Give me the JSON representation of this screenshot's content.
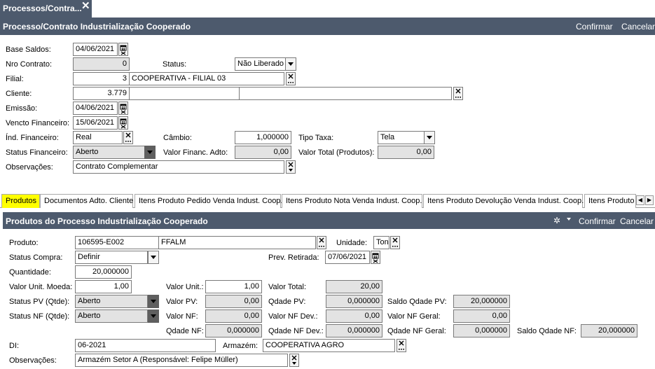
{
  "window_tab": {
    "title": "Processos/Contra...",
    "close": "✕"
  },
  "header": {
    "title": "Processo/Contrato Industrialização Cooperado",
    "confirm": "Confirmar",
    "cancel": "Cancelar"
  },
  "form": {
    "base_saldos_label": "Base Saldos:",
    "base_saldos": "04/06/2021",
    "nro_contrato_label": "Nro Contrato:",
    "nro_contrato": "0",
    "status_label": "Status:",
    "status": "Não Liberado",
    "filial_label": "Filial:",
    "filial_code": "3",
    "filial_name": "COOPERATIVA - FILIAL 03",
    "cliente_label": "Cliente:",
    "cliente_code": "3.779",
    "cliente_name": "",
    "cliente_extra": "",
    "emissao_label": "Emissão:",
    "emissao": "04/06/2021",
    "vencto_label": "Vencto Financeiro:",
    "vencto": "15/06/2021",
    "ind_fin_label": "Índ. Financeiro:",
    "ind_fin": "Real",
    "cambio_label": "Câmbio:",
    "cambio": "1,000000",
    "tipo_taxa_label": "Tipo Taxa:",
    "tipo_taxa": "Tela",
    "status_fin_label": "Status Financeiro:",
    "status_fin": "Aberto",
    "valor_financ_label": "Valor Financ. Adto:",
    "valor_financ": "0,00",
    "valor_total_label": "Valor Total (Produtos):",
    "valor_total": "0,00",
    "obs_label": "Observações:",
    "obs": "Contrato Complementar"
  },
  "tabs": [
    "Produtos",
    "Documentos Adto. Cliente",
    "Itens Produto Pedido Venda Indust. Coop.",
    "Itens Produto Nota Venda Indust. Coop.",
    "Itens Produto Devolução Venda Indust. Coop.",
    "Itens Produto"
  ],
  "sub_header": {
    "title": "Produtos do Processo Industrialização Cooperado",
    "confirm": "Confirmar",
    "cancel": "Cancelar"
  },
  "produto": {
    "produto_label": "Produto:",
    "produto_code": "106595-E002",
    "produto_name": "FFALM",
    "unidade_label": "Unidade:",
    "unidade": "Ton",
    "status_compra_label": "Status Compra:",
    "status_compra": "Definir",
    "prev_retirada_label": "Prev. Retirada:",
    "prev_retirada": "07/06/2021",
    "quantidade_label": "Quantidade:",
    "quantidade": "20,000000",
    "valor_unit_moeda_label": "Valor Unit. Moeda:",
    "valor_unit_moeda": "1,00",
    "valor_unit_label": "Valor Unit.:",
    "valor_unit": "1,00",
    "valor_total_label": "Valor Total:",
    "valor_total": "20,00",
    "status_pv_label": "Status PV (Qtde):",
    "status_pv": "Aberto",
    "valor_pv_label": "Valor PV:",
    "valor_pv": "0,00",
    "qdade_pv_label": "Qdade PV:",
    "qdade_pv": "0,000000",
    "saldo_qdade_pv_label": "Saldo Qdade PV:",
    "saldo_qdade_pv": "20,000000",
    "status_nf_label": "Status NF (Qtde):",
    "status_nf": "Aberto",
    "valor_nf_label": "Valor NF:",
    "valor_nf": "0,00",
    "valor_nf_dev_label": "Valor NF Dev.:",
    "valor_nf_dev": "0,00",
    "valor_nf_geral_label": "Valor NF Geral:",
    "valor_nf_geral": "0,00",
    "qdade_nf_label": "Qdade NF:",
    "qdade_nf": "0,000000",
    "qdade_nf_dev_label": "Qdade NF Dev.:",
    "qdade_nf_dev": "0,000000",
    "qdade_nf_geral_label": "Qdade NF Geral:",
    "qdade_nf_geral": "0,000000",
    "saldo_qdade_nf_label": "Saldo Qdade NF:",
    "saldo_qdade_nf": "20,000000",
    "di_label": "DI:",
    "di": "06-2021",
    "armazem_label": "Armazém:",
    "armazem": "COOPERATIVA AGRO",
    "obs_label": "Observações:",
    "obs": "Armazém Setor A (Responsável: Felipe Müller)"
  },
  "colors": {
    "header_bg": "#4d5a6d",
    "active_tab": "#ffff00",
    "readonly_bg": "#e3e3e3"
  }
}
